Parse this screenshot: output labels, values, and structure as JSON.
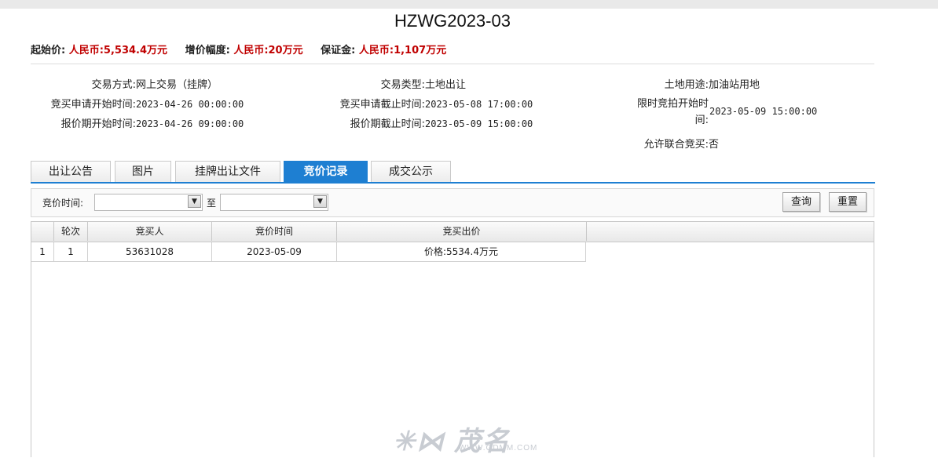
{
  "title": "HZWG2023-03",
  "prices": {
    "start_label": "起始价:",
    "start_value": "人民币:5,534.4万元",
    "step_label": "增价幅度:",
    "step_value": "人民币:20万元",
    "deposit_label": "保证金:",
    "deposit_value": "人民币:1,107万元"
  },
  "info": {
    "trade_mode_label": "交易方式:",
    "trade_mode": "网上交易（挂牌）",
    "apply_start_label": "竞买申请开始时间:",
    "apply_start": "2023-04-26 00:00:00",
    "quote_start_label": "报价期开始时间:",
    "quote_start": "2023-04-26 09:00:00",
    "trade_type_label": "交易类型:",
    "trade_type": "土地出让",
    "apply_end_label": "竞买申请截止时间:",
    "apply_end": "2023-05-08 17:00:00",
    "quote_end_label": "报价期截止时间:",
    "quote_end": "2023-05-09 15:00:00",
    "land_use_label": "土地用途:",
    "land_use": "加油站用地",
    "timed_start_label_1": "限时竞拍开始时",
    "timed_start_label_2": "间:",
    "timed_start": "2023-05-09 15:00:00",
    "joint_bid_label": "允许联合竞买:",
    "joint_bid": "否"
  },
  "tabs": [
    {
      "label": "出让公告"
    },
    {
      "label": "图片"
    },
    {
      "label": "挂牌出让文件"
    },
    {
      "label": "竞价记录"
    },
    {
      "label": "成交公示"
    }
  ],
  "active_tab": "竞价记录",
  "filter": {
    "label": "竞价时间:",
    "to_label": "至",
    "query_button": "查询",
    "reset_button": "重置"
  },
  "table": {
    "headers": [
      "",
      "轮次",
      "竞买人",
      "竞价时间",
      "竞买出价"
    ],
    "rows": [
      [
        "1",
        "1",
        "53631028",
        "2023-05-09",
        "价格:5534.4万元"
      ]
    ]
  },
  "watermark": {
    "url": "WWW.GDMM.COM"
  },
  "colors": {
    "accent": "#1e7fd2",
    "price_red": "#c00000"
  }
}
